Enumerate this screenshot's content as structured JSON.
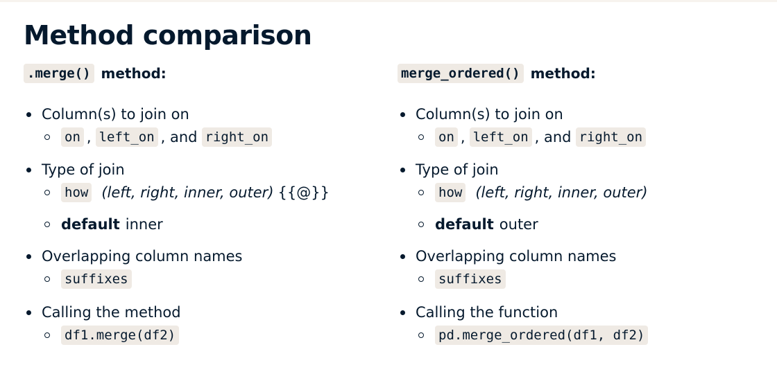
{
  "title": "Method comparison",
  "left": {
    "heading_code": ".merge()",
    "heading_text": "method:",
    "items": [
      {
        "label": "Column(s) to join on"
      },
      {
        "label": "Type of join"
      },
      {
        "label": "Overlapping column names"
      },
      {
        "label": "Calling the method"
      }
    ],
    "join_codes": [
      "on",
      "left_on",
      "right_on"
    ],
    "join_sep1": ",",
    "join_sep2": ", and",
    "how_code": "how",
    "how_options": "(left, right, inner, outer)",
    "how_extra": "{{@}}",
    "default_label": "default",
    "default_value": "inner",
    "suffixes_code": "suffixes",
    "call_code": "df1.merge(df2)"
  },
  "right": {
    "heading_code": "merge_ordered()",
    "heading_text": "method:",
    "items": [
      {
        "label": "Column(s) to join on"
      },
      {
        "label": "Type of join"
      },
      {
        "label": "Overlapping column names"
      },
      {
        "label": "Calling the function"
      }
    ],
    "join_codes": [
      "on",
      "left_on",
      "right_on"
    ],
    "join_sep1": ",",
    "join_sep2": ", and",
    "how_code": "how",
    "how_options": "(left, right, inner, outer)",
    "default_label": "default",
    "default_value": "outer",
    "suffixes_code": "suffixes",
    "call_code": "pd.merge_ordered(df1, df2)"
  }
}
